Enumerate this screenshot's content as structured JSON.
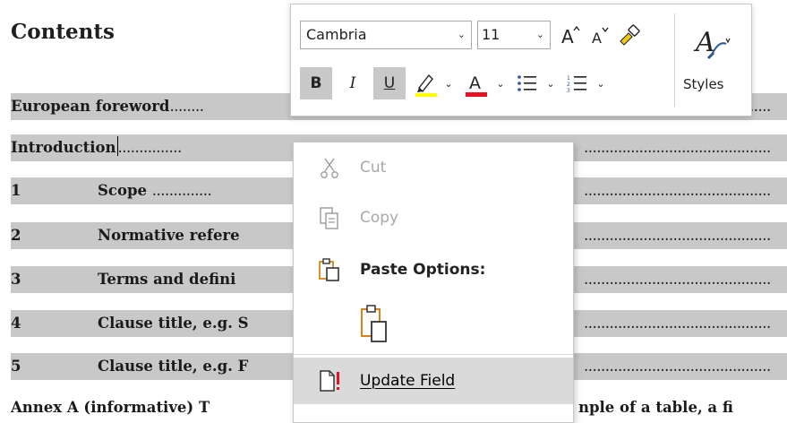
{
  "document": {
    "heading": "Contents",
    "rows": [
      {
        "num": "",
        "title": "European foreword",
        "dots_left": "........",
        "dots_right": "............................................"
      },
      {
        "num": "",
        "title": "Introduction",
        "dots_left": "...............",
        "dots_right": "............................................"
      },
      {
        "num": "1",
        "title": "Scope",
        "dots_left": "..............",
        "dots_right": "............................................"
      },
      {
        "num": "2",
        "title": "Normative refere",
        "dots_left": "",
        "dots_right": "............................................"
      },
      {
        "num": "3",
        "title": "Terms and defini",
        "dots_left": "",
        "dots_right": "............................................"
      },
      {
        "num": "4",
        "title": "Clause title, e.g. S",
        "dots_left": "",
        "dots_right": "............................................"
      },
      {
        "num": "5",
        "title": "Clause title, e.g. F",
        "dots_left": "",
        "dots_right": "............................................"
      }
    ],
    "annex_left": "Annex A (informative)  T",
    "annex_right": "nple of a table, a fi"
  },
  "mini_toolbar": {
    "font_name": "Cambria",
    "font_size": "11",
    "styles_label": "Styles",
    "highlight_color": "#ffff00",
    "font_color": "#e81123"
  },
  "context_menu": {
    "cut": "Cut",
    "copy": "Copy",
    "paste_options": "Paste Options:",
    "update_field": "Update Field"
  }
}
